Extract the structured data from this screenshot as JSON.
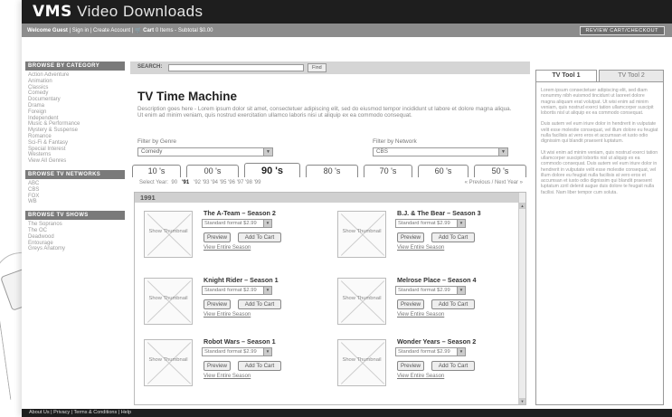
{
  "header": {
    "brand_bold": "VMS",
    "brand_rest": "Video Downloads",
    "welcome": "Welcome Guest",
    "links": "| Sign in | Create Account | ",
    "cart_icon": "cart-icon",
    "cart": "Cart",
    "cart_info": "0 Items - Subtotal $0.00",
    "review_checkout": "REVIEW CART/CHECKOUT"
  },
  "sidebar": {
    "categories_head": "BROWSE BY CATEGORY",
    "categories": [
      "Action Adventure",
      "Animation",
      "Classics",
      "Comedy",
      "Documentary",
      "Drama",
      "Foreign",
      "Independent",
      "Music & Performance",
      "Mystery & Suspense",
      "Romance",
      "Sci-Fi & Fantasy",
      "Special Interest",
      "Westerns",
      "View All Genres"
    ],
    "networks_head": "BROWSE TV NETWORKS",
    "networks": [
      "ABC",
      "CBS",
      "FOX",
      "WB"
    ],
    "shows_head": "BROWSE TV SHOWS",
    "shows": [
      "The Sopranos",
      "The OC",
      "Deadwood",
      "Entourage",
      "Greys Anatomy"
    ]
  },
  "search": {
    "label": "SEARCH:",
    "placeholder": "",
    "find_label": "Find"
  },
  "main": {
    "title": "TV Time Machine",
    "description": "Description goes here - Lorem ipsum dolor sit amet, consectetuer adipiscing elit, sed do eiusmod tempor incididunt ut labore et dolore magna aliqua. Ut enim ad minim veniam, quis nostrud exercitation ullamco laboris nisi ut aliquip ex ea commodo consequat.",
    "genre_label": "Filter by Genre",
    "genre_value": "Comedy",
    "network_label": "Filter by Network",
    "network_value": "CBS",
    "decade_tabs": [
      "10 's",
      "00 's",
      "90 's",
      "80 's",
      "70 's",
      "60 's",
      "50 's"
    ],
    "active_tab": "90 's",
    "select_year_label": "Select Year:",
    "years_before": "90",
    "year_selected": "'91",
    "years_after": "'92   '93   '94   '95   '96   '97   '98   '99",
    "year_nav": "«  Previous / Next Year  »",
    "current_year": "1991"
  },
  "items": [
    {
      "title": "The A-Team – Season 2",
      "thumb": "Show Thumbnail",
      "format": "Standard format  $2.99",
      "preview": "Preview",
      "cart": "Add To Cart",
      "view": "View Entire Season"
    },
    {
      "title": "B.J. & The Bear – Season 3",
      "thumb": "Show Thumbnail",
      "format": "Standard format  $2.99",
      "preview": "Preview",
      "cart": "Add To Cart",
      "view": "View Entire Season"
    },
    {
      "title": "Knight Rider – Season 1",
      "thumb": "Show Thumbnail",
      "format": "Standard format  $2.99",
      "preview": "Preview",
      "cart": "Add To Cart",
      "view": "View Entire Season"
    },
    {
      "title": "Melrose Place – Season 4",
      "thumb": "Show Thumbnail",
      "format": "Standard format  $2.99",
      "preview": "Preview",
      "cart": "Add To Cart",
      "view": "View Entire Season"
    },
    {
      "title": "Robot Wars – Season 1",
      "thumb": "Show Thumbnail",
      "format": "Standard format  $2.99",
      "preview": "Preview",
      "cart": "Add To Cart",
      "view": "View Entire Season"
    },
    {
      "title": "Wonder Years – Season 2",
      "thumb": "Show Thumbnail",
      "format": "Standard format  $2.99",
      "preview": "Preview",
      "cart": "Add To Cart",
      "view": "View Entire Season"
    }
  ],
  "right": {
    "tab1": "TV Tool 1",
    "tab2": "TV Tool 2",
    "p1": "Lorem ipsum consectetuer adipiscing elit, sed diam nonummy nibh euismod tincidunt ut laoreet dolore magna aliquam erat volutpat. Ut wisi enim ad minim veniam, quis nostrud exerci tation ullamcorper suscipit lobortis nisl ut aliquip ex ea commodo consequat.",
    "p2": "Duis autem vel eum iriure dolor in hendrerit in vulputate velit esse molestie consequat, vel illum dolore eu feugiat nulla facilisis at vero eros et accumsan et iusto odio dignissim qui blandit praesent luptatum.",
    "p3": "Ut wisi enim ad minim veniam, quis nostrud exerci tation ullamcorper suscipit lobortis nisl ut aliquip ex ea commodo consequat. Duis autem vel eum iriure dolor in hendrerit in vulputate velit esse molestie consequat, vel illum dolore eu feugiat nulla facilisis at vero eros et accumsan et iusto odio dignissim qui blandit praesent luptatum zzril delenit augue duis dolore te feugait nulla facilisi. Nam liber tempor cum soluta."
  },
  "footer": {
    "text": "About Us | Privacy | Terms & Conditions | Help"
  }
}
